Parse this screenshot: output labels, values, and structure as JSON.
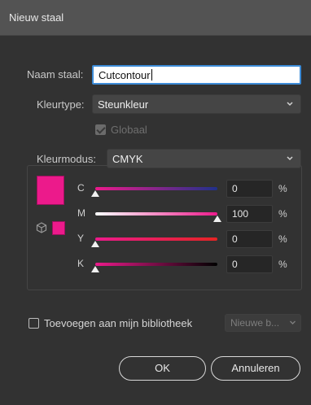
{
  "window": {
    "title": "Nieuw staal"
  },
  "swatch_name": {
    "label": "Naam staal:",
    "value": "Cutcontour"
  },
  "color_type": {
    "label": "Kleurtype:",
    "value": "Steunkleur"
  },
  "global": {
    "label": "Globaal",
    "checked": true,
    "disabled": true
  },
  "color_mode": {
    "label": "Kleurmodus:",
    "value": "CMYK"
  },
  "swatch_color": "#ec1a8b",
  "channels": [
    {
      "label": "C",
      "value": "0",
      "unit": "%",
      "level": 0
    },
    {
      "label": "M",
      "value": "100",
      "unit": "%",
      "level": 100
    },
    {
      "label": "Y",
      "value": "0",
      "unit": "%",
      "level": 0
    },
    {
      "label": "K",
      "value": "0",
      "unit": "%",
      "level": 0
    }
  ],
  "library": {
    "label": "Toevoegen aan mijn bibliotheek",
    "checked": false,
    "select_value": "Nieuwe b..."
  },
  "buttons": {
    "ok": "OK",
    "cancel": "Annuleren"
  },
  "icons": {
    "chevron": "chevron-down-icon",
    "cube": "cube-icon"
  }
}
